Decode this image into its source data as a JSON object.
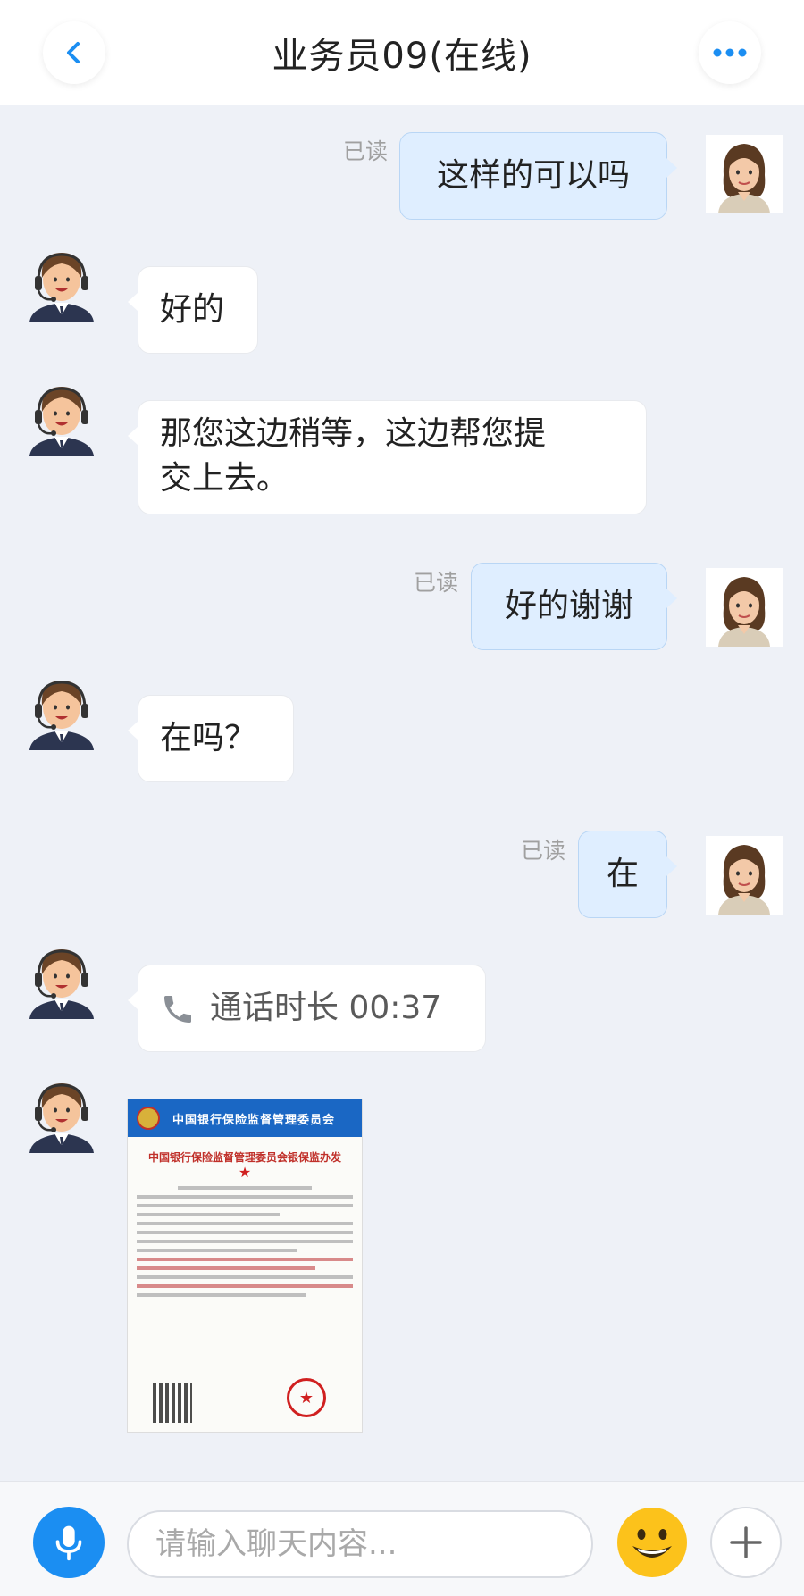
{
  "header": {
    "title": "业务员09(在线)",
    "back_icon": "chevron-left-icon",
    "more_icon": "more-dots-icon",
    "accent": "#1b8ef2"
  },
  "messages": [
    {
      "sender": "me",
      "text": "这样的可以吗",
      "status": "已读"
    },
    {
      "sender": "agent",
      "text": "好的"
    },
    {
      "sender": "agent",
      "text_lines": [
        "那您这边稍等，这边帮您提",
        "交上去。"
      ]
    },
    {
      "sender": "me",
      "text": "好的谢谢",
      "status": "已读"
    },
    {
      "sender": "agent",
      "text": "在吗？"
    },
    {
      "sender": "me",
      "text": "在",
      "status": "已读"
    },
    {
      "sender": "agent",
      "type": "call",
      "icon": "phone-icon",
      "text": "通话时长  00:37"
    },
    {
      "sender": "agent",
      "type": "image",
      "org": "中国银行保险监督管理委员会",
      "doc_title": "中国银行保险监督管理委员会银保监办发"
    }
  ],
  "input_bar": {
    "placeholder": "请输入聊天内容...",
    "mic_icon": "microphone-icon",
    "emoji_icon": "emoji-icon",
    "add_icon": "plus-icon"
  }
}
